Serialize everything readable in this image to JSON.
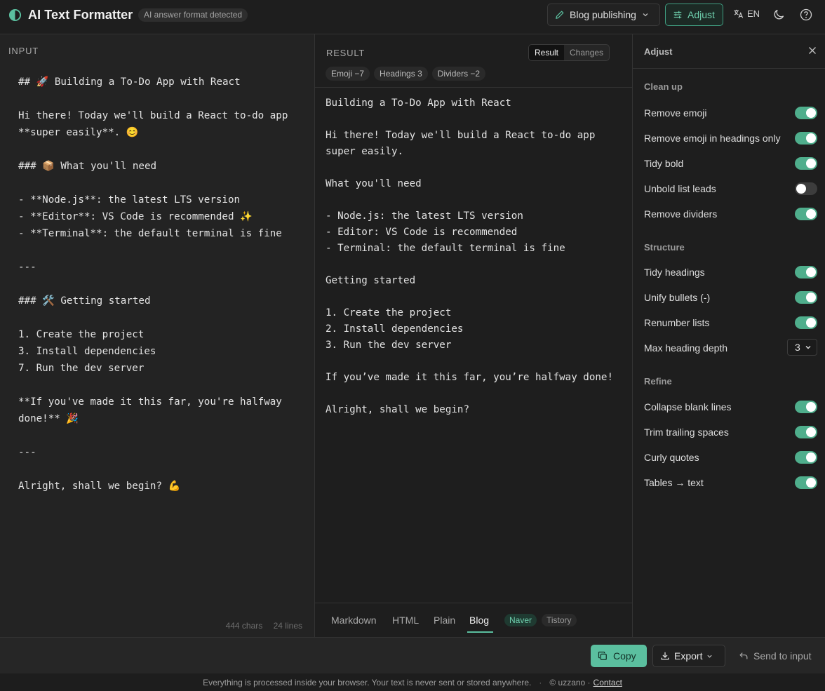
{
  "header": {
    "app_title": "AI Text Formatter",
    "detect_badge": "AI answer format detected",
    "preset_label": "Blog publishing",
    "adjust_label": "Adjust",
    "language_label": "EN",
    "accent_color": "#5bbf9f"
  },
  "input": {
    "section_label": "INPUT",
    "text": "## 🚀 Building a To-Do App with React\n\nHi there! Today we'll build a React to-do app\n**super easily**. 😊\n\n### 📦 What you'll need\n\n- **Node.js**: the latest LTS version\n- **Editor**: VS Code is recommended ✨\n- **Terminal**: the default terminal is fine\n\n---\n\n### 🛠️ Getting started\n\n1. Create the project\n3. Install dependencies\n7. Run the dev server\n\n**If you've made it this far, you're halfway\ndone!** 🎉\n\n---\n\nAlright, shall we begin? 💪",
    "chars": "444 chars",
    "lines": "24 lines"
  },
  "result": {
    "section_label": "RESULT",
    "view_toggle": [
      "Result",
      "Changes"
    ],
    "active_view": "Result",
    "chips": [
      "Emoji −7",
      "Headings 3",
      "Dividers −2"
    ],
    "text": "Building a To-Do App with React\n\nHi there! Today we'll build a React to-do app\nsuper easily.\n\nWhat you'll need\n\n- Node.js: the latest LTS version\n- Editor: VS Code is recommended\n- Terminal: the default terminal is fine\n\nGetting started\n\n1. Create the project\n2. Install dependencies\n3. Run the dev server\n\nIf you’ve made it this far, you’re halfway done!\n\nAlright, shall we begin?",
    "tabs": [
      "Markdown",
      "HTML",
      "Plain",
      "Blog"
    ],
    "active_tab": "Blog",
    "subtabs": [
      "Naver",
      "Tistory"
    ],
    "active_subtab": "Naver"
  },
  "adjust": {
    "title": "Adjust",
    "groups": [
      {
        "label": "Clean up",
        "options": [
          {
            "label": "Remove emoji",
            "on": true
          },
          {
            "label": "Remove emoji in headings only",
            "on": true
          },
          {
            "label": "Tidy bold",
            "on": true
          },
          {
            "label": "Unbold list leads",
            "on": false
          },
          {
            "label": "Remove dividers",
            "on": true
          }
        ]
      },
      {
        "label": "Structure",
        "options": [
          {
            "label": "Tidy headings",
            "on": true
          },
          {
            "label": "Unify bullets (-)",
            "on": true
          },
          {
            "label": "Renumber lists",
            "on": true
          }
        ],
        "max_depth_label": "Max heading depth",
        "max_depth_value": "3"
      },
      {
        "label": "Refine",
        "options": [
          {
            "label": "Collapse blank lines",
            "on": true
          },
          {
            "label": "Trim trailing spaces",
            "on": true
          },
          {
            "label": "Curly quotes",
            "on": true
          },
          {
            "label": "Tables → text",
            "on": true
          }
        ]
      }
    ]
  },
  "actions": {
    "copy": "Copy",
    "export": "Export",
    "send": "Send to input"
  },
  "footer": {
    "privacy": "Everything is processed inside your browser. Your text is never sent or stored anywhere.",
    "copyright": "© uzzano ·",
    "contact": "Contact"
  }
}
